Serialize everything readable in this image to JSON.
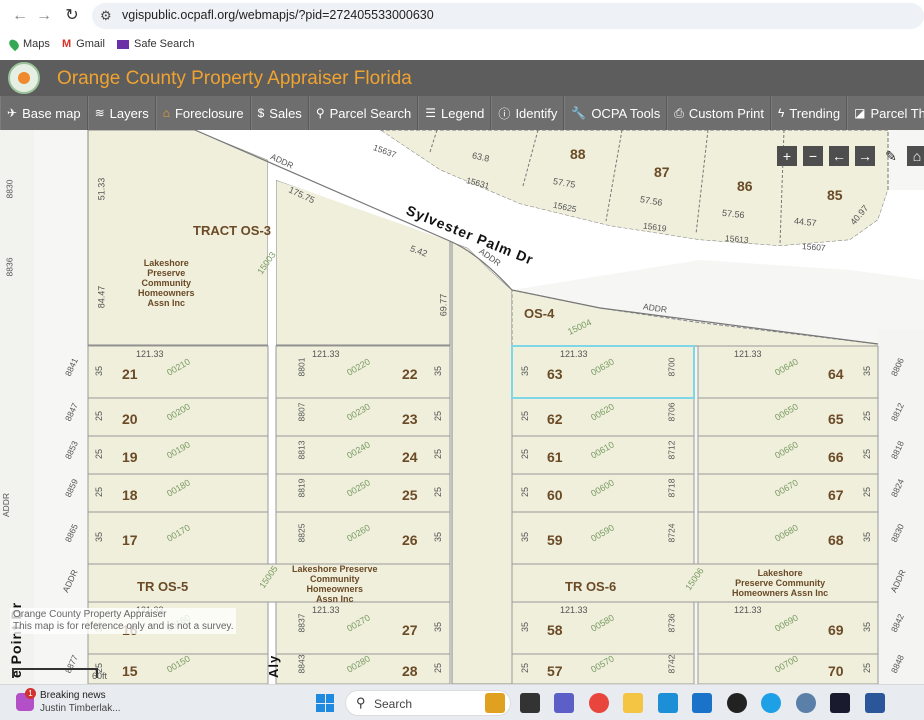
{
  "browser": {
    "url": "vgispublic.ocpafl.org/webmapjs/?pid=272405533000630",
    "bookmarks": [
      {
        "label": "Maps",
        "icon": "maps-pin-icon",
        "color": "#34a853"
      },
      {
        "label": "Gmail",
        "icon": "gmail-icon",
        "color": "#d93025"
      },
      {
        "label": "Safe Search",
        "icon": "mail-envelope-icon",
        "color": "#6b2fa6"
      }
    ]
  },
  "app": {
    "title": "Orange County Property Appraiser Florida",
    "title_color": "#f0a330",
    "toolbar": [
      {
        "label": "Base map",
        "icon": "✈",
        "icon_name": "plane-icon"
      },
      {
        "label": "Layers",
        "icon": "≋",
        "icon_name": "layers-icon"
      },
      {
        "label": "Foreclosure",
        "icon": "⌂",
        "icon_name": "house-icon"
      },
      {
        "label": "Sales",
        "icon": "$",
        "icon_name": "dollar-icon"
      },
      {
        "label": "Parcel Search",
        "icon": "⚲",
        "icon_name": "search-icon"
      },
      {
        "label": "Legend",
        "icon": "☰",
        "icon_name": "list-icon"
      },
      {
        "label": "Identify",
        "icon": "ⓘ",
        "icon_name": "info-icon"
      },
      {
        "label": "OCPA Tools",
        "icon": "🔧",
        "icon_name": "wrench-icon"
      },
      {
        "label": "Custom Print",
        "icon": "⎙",
        "icon_name": "printer-icon"
      },
      {
        "label": "Trending",
        "icon": "ϟ",
        "icon_name": "bolt-icon"
      },
      {
        "label": "Parcel Theme",
        "icon": "◪",
        "icon_name": "theme-icon"
      }
    ]
  },
  "map": {
    "controls": [
      {
        "symbol": "+",
        "name": "zoom-in-button"
      },
      {
        "symbol": "−",
        "name": "zoom-out-button"
      },
      {
        "symbol": "←",
        "name": "previous-extent-button"
      },
      {
        "symbol": "→",
        "name": "next-extent-button"
      },
      {
        "symbol": "✎",
        "name": "eraser-button"
      },
      {
        "symbol": "⌂",
        "name": "home-button"
      }
    ],
    "streets": {
      "main": "Sylvester Palm Dr",
      "left": "e Point Dr",
      "alley": "Aly"
    },
    "tracts": {
      "os3": "TRACT OS-3",
      "os4": "OS-4",
      "os5": "TR OS-5",
      "os6": "TR OS-6"
    },
    "owners": {
      "os3": [
        "Lakeshore",
        "Preserve",
        "Community",
        "Homeowners",
        "Assn Inc"
      ],
      "os5": [
        "Lakeshore Preserve",
        "Community",
        "Homeowners",
        "Assn Inc"
      ],
      "os6": [
        "Lakeshore",
        "Preserve Community",
        "Homeowners Assn Inc"
      ]
    },
    "top_lots": [
      {
        "lot": "88",
        "dim": "57.75"
      },
      {
        "lot": "87",
        "dim": "57.56"
      },
      {
        "lot": "86",
        "dim": "57.56"
      },
      {
        "lot": "85",
        "dim": "44.57"
      }
    ],
    "top_misc": {
      "dim_638": "63.8",
      "dim_4097": "40.97",
      "dim_17575": "175.75",
      "dim_542": "5.42",
      "dim_6977": "69.77",
      "dim_5133": "51.33",
      "dim_8447": "84.47",
      "addr_15637": "15637",
      "addr_15631": "15631",
      "addr_15625": "15625",
      "addr_15619": "15619",
      "addr_15613": "15613",
      "addr_15607": "15607",
      "addr_8830": "8830",
      "addr_8836": "8836",
      "pid_15003": "15003",
      "pid_15004": "15004",
      "pid_15005": "15005",
      "pid_15006": "15006",
      "addr_label": "ADDR",
      "frontage": "121.33",
      "scale": "60ft"
    },
    "col_a": [
      {
        "lot": "21",
        "pid": "00210",
        "width": "35",
        "addr": "8841"
      },
      {
        "lot": "20",
        "pid": "00200",
        "width": "25",
        "addr": "8847"
      },
      {
        "lot": "19",
        "pid": "00190",
        "width": "25",
        "addr": "8853"
      },
      {
        "lot": "18",
        "pid": "00180",
        "width": "25",
        "addr": "8859"
      },
      {
        "lot": "17",
        "pid": "00170",
        "width": "35",
        "addr": "8865"
      },
      {
        "lot": "16",
        "pid": "00160",
        "width": "35",
        "addr": ""
      },
      {
        "lot": "15",
        "pid": "00150",
        "width": "25",
        "addr": "8877"
      }
    ],
    "col_b": [
      {
        "lot": "22",
        "pid": "00220",
        "width": "35",
        "addr": "8801"
      },
      {
        "lot": "23",
        "pid": "00230",
        "width": "25",
        "addr": "8807"
      },
      {
        "lot": "24",
        "pid": "00240",
        "width": "25",
        "addr": "8813"
      },
      {
        "lot": "25",
        "pid": "00250",
        "width": "25",
        "addr": "8819"
      },
      {
        "lot": "26",
        "pid": "00260",
        "width": "35",
        "addr": "8825"
      },
      {
        "lot": "27",
        "pid": "00270",
        "width": "35",
        "addr": "8837"
      },
      {
        "lot": "28",
        "pid": "00280",
        "width": "25",
        "addr": "8843"
      }
    ],
    "col_c": [
      {
        "lot": "63",
        "pid": "00630",
        "width": "35",
        "addr": "8700"
      },
      {
        "lot": "62",
        "pid": "00620",
        "width": "25",
        "addr": "8706"
      },
      {
        "lot": "61",
        "pid": "00610",
        "width": "25",
        "addr": "8712"
      },
      {
        "lot": "60",
        "pid": "00600",
        "width": "25",
        "addr": "8718"
      },
      {
        "lot": "59",
        "pid": "00590",
        "width": "35",
        "addr": "8724"
      },
      {
        "lot": "58",
        "pid": "00580",
        "width": "35",
        "addr": "8736"
      },
      {
        "lot": "57",
        "pid": "00570",
        "width": "25",
        "addr": "8742"
      }
    ],
    "col_d": [
      {
        "lot": "64",
        "pid": "00640",
        "width": "35",
        "addr": "8806"
      },
      {
        "lot": "65",
        "pid": "00650",
        "width": "25",
        "addr": "8812"
      },
      {
        "lot": "66",
        "pid": "00660",
        "width": "25",
        "addr": "8818"
      },
      {
        "lot": "67",
        "pid": "00670",
        "width": "25",
        "addr": "8824"
      },
      {
        "lot": "68",
        "pid": "00680",
        "width": "35",
        "addr": "8830"
      },
      {
        "lot": "69",
        "pid": "00690",
        "width": "35",
        "addr": "8842"
      },
      {
        "lot": "70",
        "pid": "00700",
        "width": "25",
        "addr": "8848"
      }
    ],
    "disclaimer": [
      "Orange County Property Appraiser",
      "This map is for reference only and is not a survey."
    ],
    "selected_parcel_color": "#7fd6e6",
    "parcel_fill": "#efefdc"
  },
  "taskbar": {
    "news_title": "Breaking news",
    "news_sub": "Justin Timberlak...",
    "news_badge": "1",
    "search_label": "Search",
    "apps": [
      {
        "name": "briefcase-icon",
        "color": "#e0a020"
      },
      {
        "name": "task-view-icon",
        "color": "#333333"
      },
      {
        "name": "teams-icon",
        "color": "#5b5fc7"
      },
      {
        "name": "chrome-icon",
        "color": "#e8453c"
      },
      {
        "name": "file-explorer-icon",
        "color": "#f4c542"
      },
      {
        "name": "edge-icon",
        "color": "#1d8fd6"
      },
      {
        "name": "store-icon",
        "color": "#1a73c9"
      },
      {
        "name": "dell-icon",
        "color": "#222222"
      },
      {
        "name": "cortana-icon",
        "color": "#1ea0e6"
      },
      {
        "name": "settings-icon",
        "color": "#5a7fa8"
      },
      {
        "name": "waves-icon",
        "color": "#1a1a2e"
      },
      {
        "name": "word-icon",
        "color": "#2b579a"
      }
    ]
  }
}
